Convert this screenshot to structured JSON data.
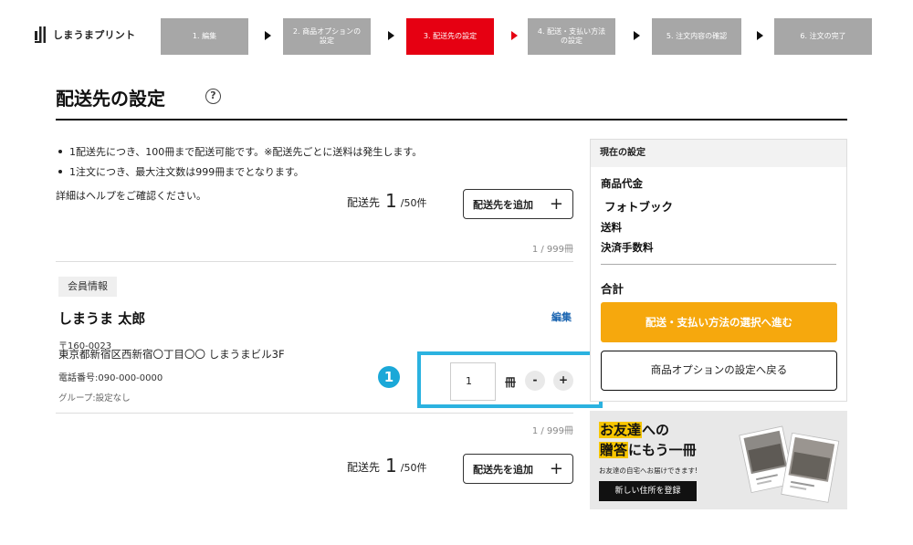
{
  "header": {
    "logo_text": "しまうまプリント",
    "steps": [
      {
        "line1": "1. 編集",
        "line2": ""
      },
      {
        "line1": "2. 商品オプションの",
        "line2": "設定"
      },
      {
        "line1": "3. 配送先の設定",
        "line2": ""
      },
      {
        "line1": "4. 配送・支払い方法",
        "line2": "の設定"
      },
      {
        "line1": "5. 注文内容の確認",
        "line2": ""
      },
      {
        "line1": "6. 注文の完了",
        "line2": ""
      }
    ]
  },
  "page": {
    "title": "配送先の設定",
    "help_symbol": "?"
  },
  "notes": {
    "items": [
      "1配送先につき、100冊まで配送可能です。※配送先ごとに送料は発生します。",
      "1注文につき、最大注文数は999冊までとなります。"
    ],
    "help_text": "詳細はヘルプをご確認ください。"
  },
  "shipping": {
    "label": "配送先",
    "count": "1",
    "max": "/50件",
    "add_button": "配送先を追加",
    "plus": "+",
    "copies_count": "1 / 999冊"
  },
  "member": {
    "badge": "会員情報",
    "name": "しまうま 太郎",
    "edit": "編集",
    "postal": "〒160-0023",
    "address": "東京都新宿区西新宿〇丁目〇〇 しまうまビル3F",
    "phone": "電話番号:090-000-0000",
    "group": "グループ:設定なし"
  },
  "quantity": {
    "callout": "❶",
    "value": "1",
    "unit": "冊",
    "minus": "-",
    "plus": "+"
  },
  "panel": {
    "header": "現在の設定",
    "product_price": "商品代金",
    "product_name": "フォトブック",
    "shipping_fee": "送料",
    "payment_fee": "決済手数料",
    "total": "合計",
    "cta": "配送・支払い方法の選択へ進む",
    "back": "商品オプションの設定へ戻る"
  },
  "banner": {
    "line1_hl": "お友達",
    "line1_rest": "への",
    "line2_hl": "贈答",
    "line2_rest": "にもう一冊",
    "sub": "お友達の自宅へお届けできます!",
    "button": "新しい住所を登録"
  },
  "colors": {
    "step_inactive": "#a7a7a7",
    "step_active": "#e60012",
    "cta": "#f6a80d",
    "callout": "#1ba8d8",
    "highlight": "#f7c600",
    "link": "#1a64b0"
  }
}
